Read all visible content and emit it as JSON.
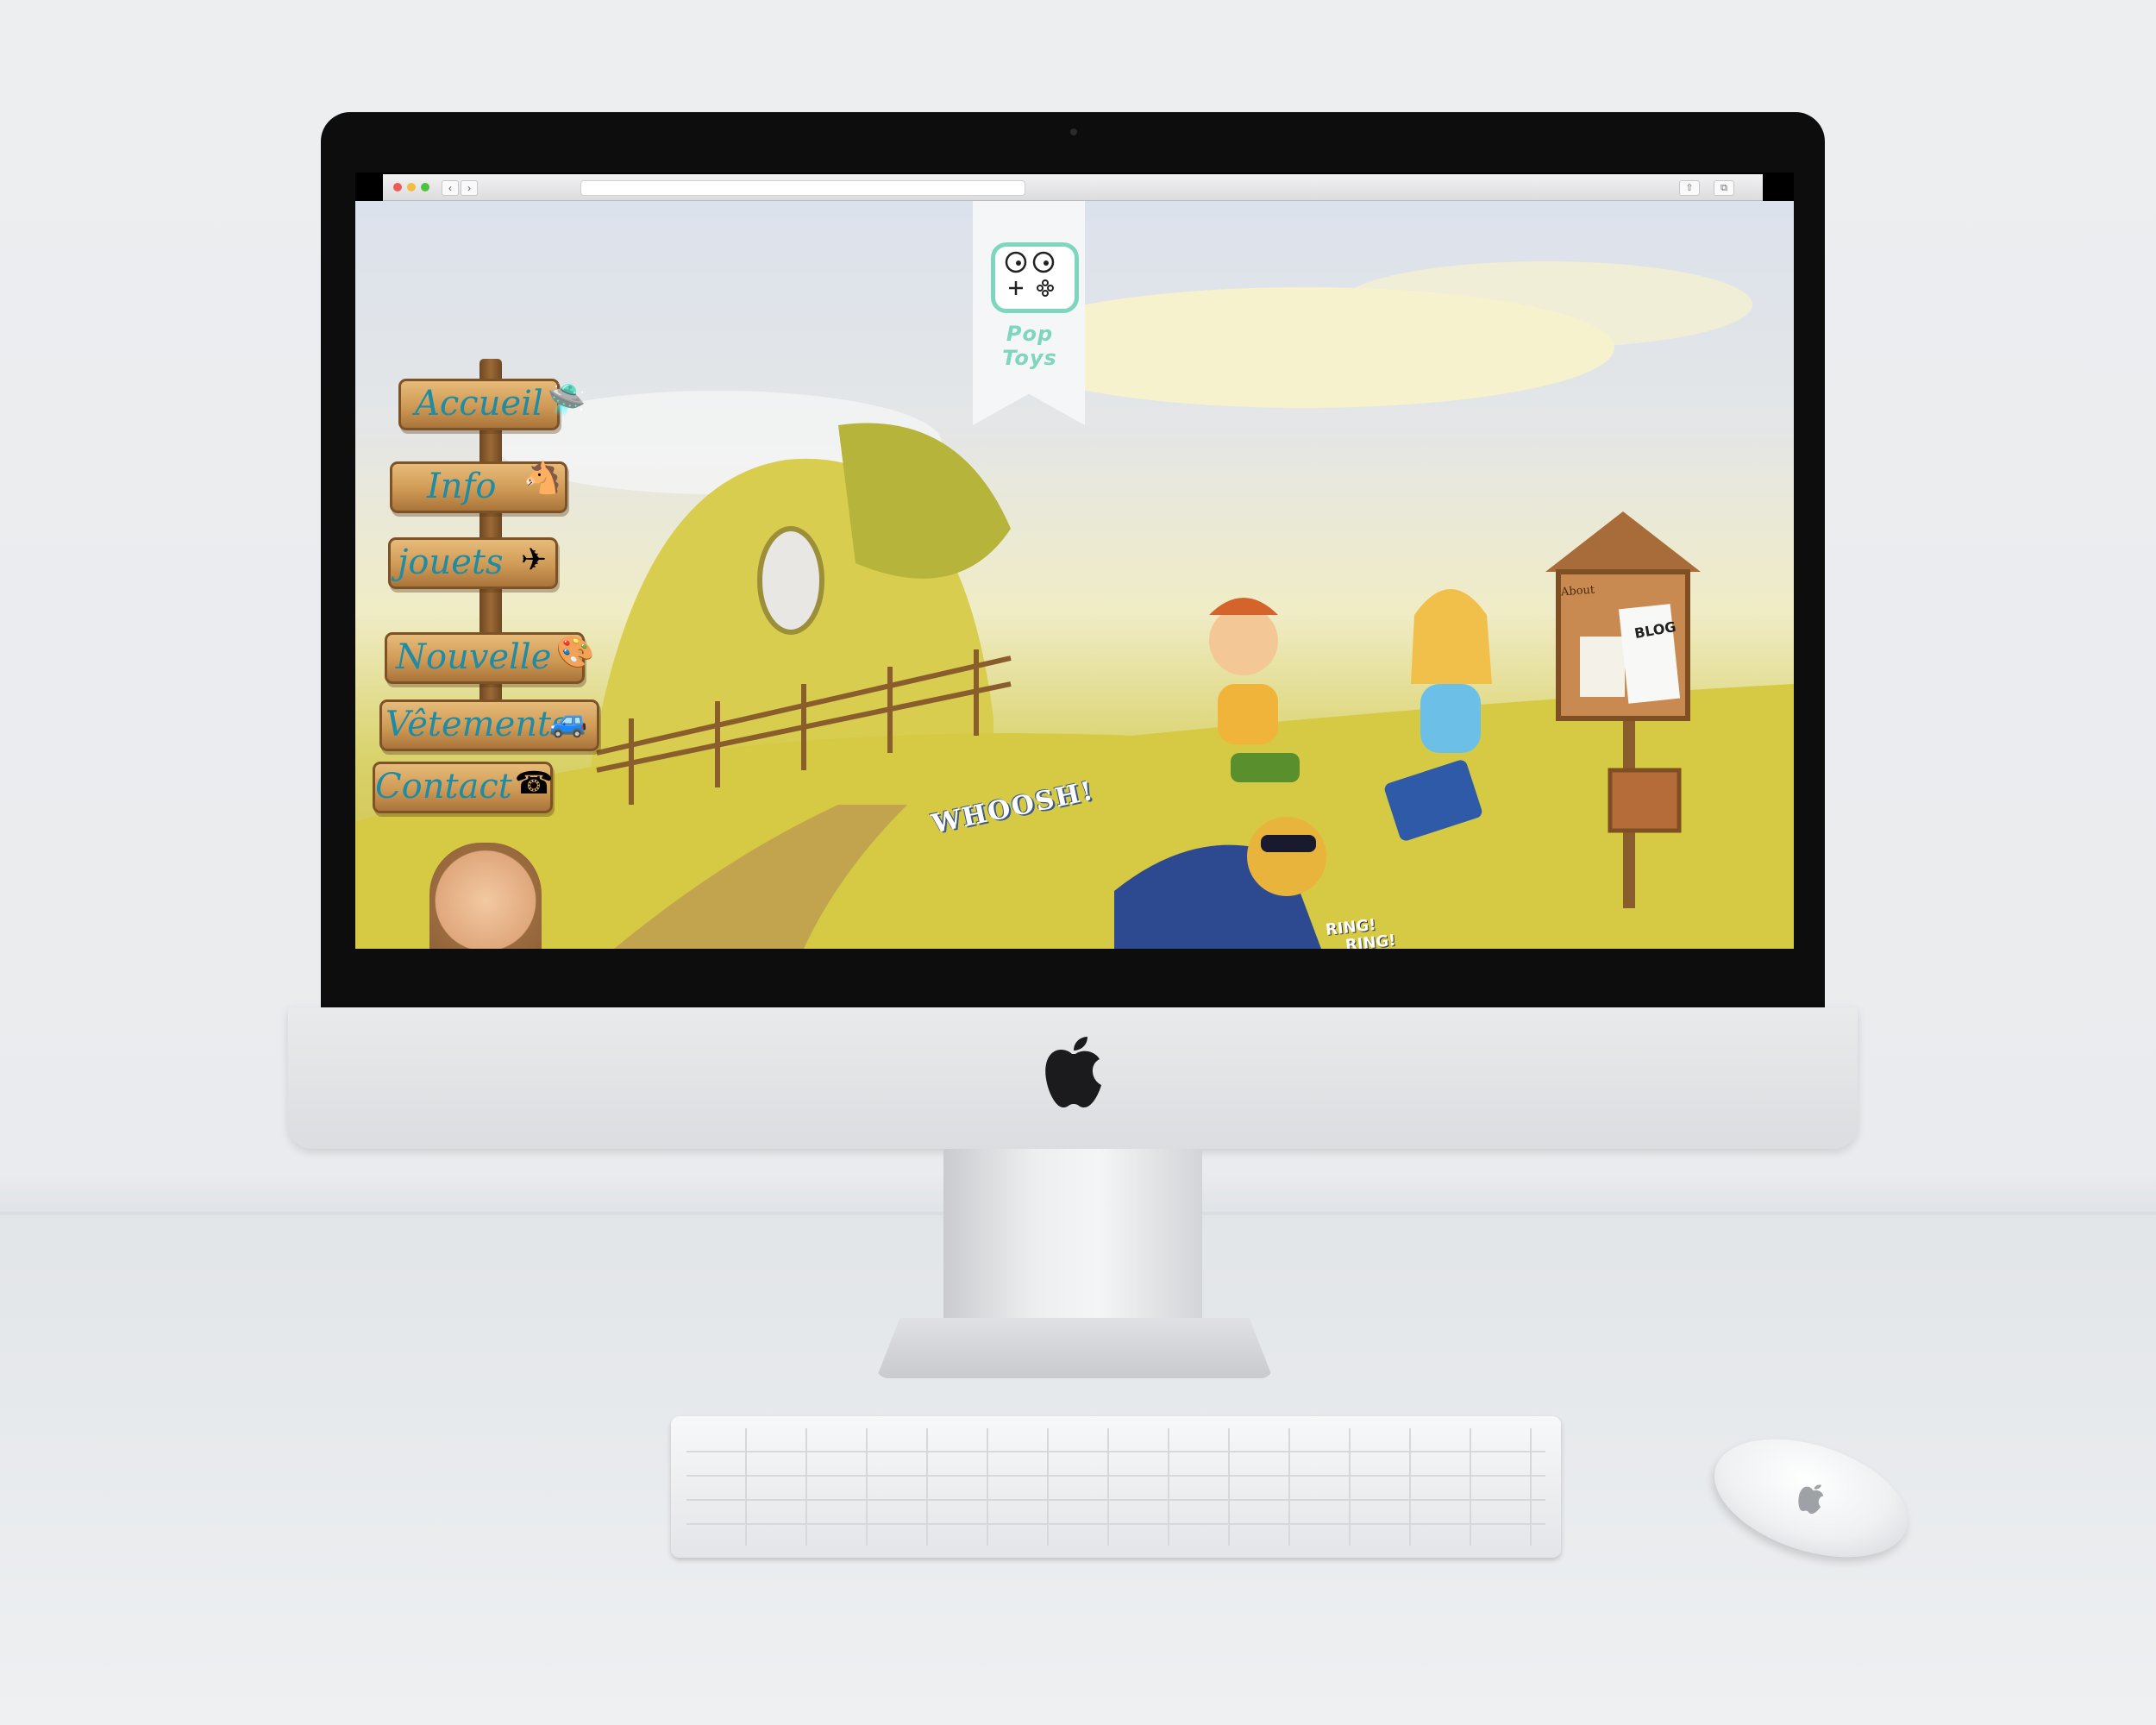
{
  "browser": {
    "back_glyph": "‹",
    "forward_glyph": "›",
    "share_glyph": "⇧",
    "tabs_glyph": "⧉"
  },
  "site": {
    "logo_text": "Pop Toys",
    "nav": [
      {
        "label": "Accueil",
        "icon": "toy-ufo-icon",
        "glyph": "🛸"
      },
      {
        "label": "Info",
        "icon": "rocking-horse-icon",
        "glyph": "🐴"
      },
      {
        "label": "jouets",
        "icon": "toy-plane-icon",
        "glyph": "✈"
      },
      {
        "label": "Nouvelle",
        "icon": "paint-palette-icon",
        "glyph": "🎨"
      },
      {
        "label": "Vêtements",
        "icon": "toy-car-icon",
        "glyph": "🚙"
      },
      {
        "label": "Contact",
        "icon": "toy-phone-icon",
        "glyph": "☎"
      }
    ],
    "sound_effects": {
      "whoosh": "WHOOSH!",
      "ring1": "RING!",
      "ring2": "RING!"
    },
    "mailbox": {
      "about": "About",
      "blog": "BLOG"
    }
  },
  "colors": {
    "nav_text": "#1e8ca4",
    "logo_accent": "#7fd6bf"
  }
}
